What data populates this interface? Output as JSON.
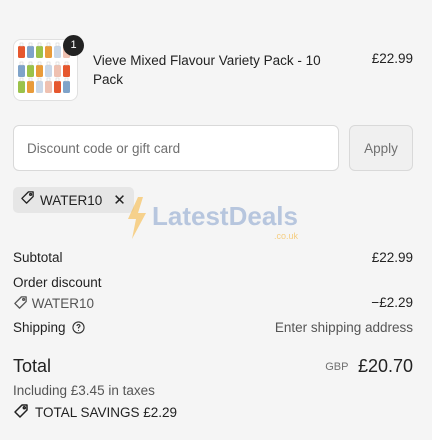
{
  "cart": {
    "item": {
      "name": "Vieve Mixed Flavour Variety Pack - 10 Pack",
      "price": "£22.99",
      "quantity": "1",
      "thumbnail_colors": [
        "#e6572e",
        "#7fa3c9",
        "#9bc24a",
        "#e99b3a",
        "#c9d7e8",
        "#efc1b1"
      ]
    }
  },
  "discount": {
    "placeholder": "Discount code or gift card",
    "value": "",
    "apply_label": "Apply",
    "applied_code": "WATER10",
    "tag_icon": "tag-icon",
    "remove_icon": "close-icon"
  },
  "watermark": {
    "brand": "LatestDeals",
    "suffix": ".co.uk",
    "accent": "#f5b335",
    "text_color": "#7b98c9"
  },
  "summary": {
    "subtotal_label": "Subtotal",
    "subtotal_value": "£22.99",
    "order_discount_label": "Order discount",
    "order_discount_code": "WATER10",
    "order_discount_value": "−£2.29",
    "shipping_label": "Shipping",
    "shipping_value": "Enter shipping address",
    "total_label": "Total",
    "currency": "GBP",
    "total_value": "£20.70",
    "taxes_text": "Including £3.45 in taxes",
    "savings_text": "TOTAL SAVINGS £2.29"
  }
}
